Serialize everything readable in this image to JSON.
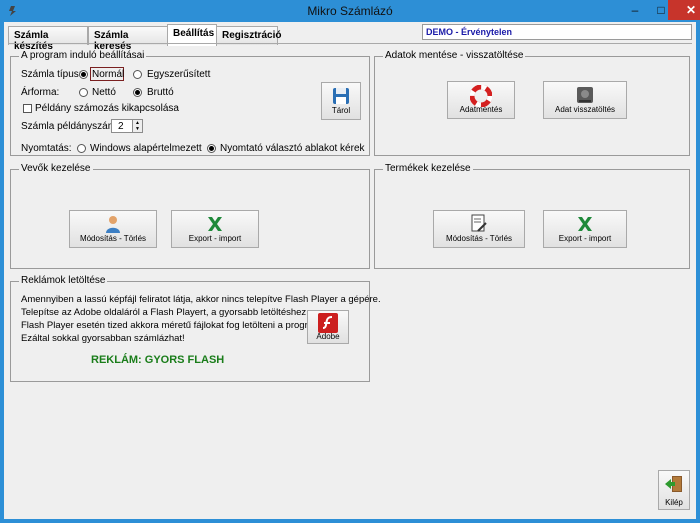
{
  "window": {
    "title": "Mikro Számlázó",
    "min_glyph": "–",
    "max_glyph": "□",
    "close_glyph": "✕"
  },
  "tabs": [
    {
      "label": "Számla készítés"
    },
    {
      "label": "Számla keresés"
    },
    {
      "label": "Beállítás"
    },
    {
      "label": "Regisztráció"
    }
  ],
  "demo_label": "DEMO - Érvénytelen",
  "startup": {
    "title": "A program induló beállításai",
    "invoice_type_label": "Számla típus:",
    "invoice_type_options": [
      "Normál",
      "Egyszerűsített"
    ],
    "price_type_label": "Árforma:",
    "price_type_options": [
      "Nettó",
      "Bruttó"
    ],
    "copy_numbering_label": "Példány számozás kikapcsolása",
    "copies_label": "Számla példányszám:",
    "copies_value": "2",
    "print_label": "Nyomtatás:",
    "print_options": [
      "Windows alapértelmezett",
      "Nyomtató választó ablakot kérek"
    ],
    "save_label": "Tárol"
  },
  "backup": {
    "title": "Adatok mentése - visszatöltése",
    "save_label": "Adatmentés",
    "restore_label": "Adat visszatöltés"
  },
  "customers": {
    "title": "Vevők kezelése",
    "edit_label": "Módosítás - Törlés",
    "export_label": "Export - import"
  },
  "products": {
    "title": "Termékek kezelése",
    "edit_label": "Módosítás - Törlés",
    "export_label": "Export - import"
  },
  "ads": {
    "title": "Reklámok letöltése",
    "lines": [
      "Amennyiben a lassú képfájl feliratot látja, akkor nincs telepítve Flash Player a gépére.",
      "Telepítse az Adobe oldaláról a Flash Playert, a gyorsabb letöltéshez.",
      "Flash Player esetén tized akkora méretű fájlokat fog letölteni a program.",
      "Ezáltal sokkal gyorsabban számlázhat!"
    ],
    "flash_text": "REKLÁM: GYORS FLASH",
    "adobe_label": "Adobe"
  },
  "exit_label": "Kilép"
}
